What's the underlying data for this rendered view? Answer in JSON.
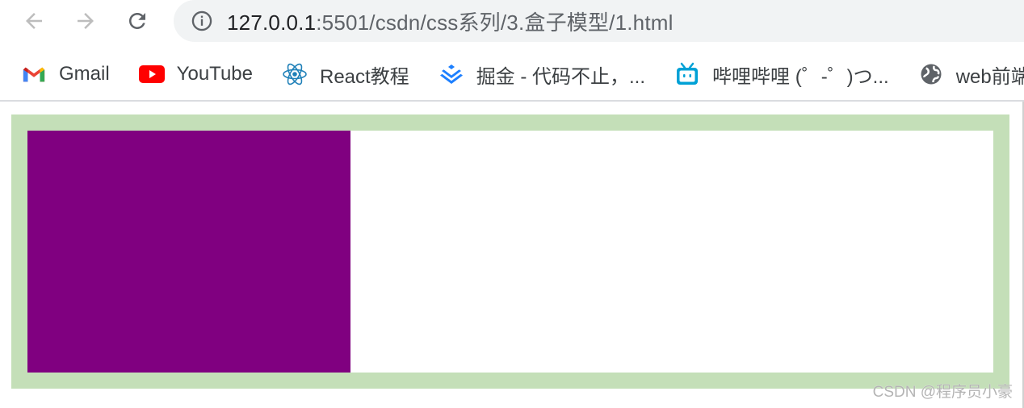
{
  "browser": {
    "nav": {
      "back_icon": "arrow-left-icon",
      "forward_icon": "arrow-right-icon",
      "reload_icon": "reload-icon"
    },
    "omnibox": {
      "info_icon": "info-icon",
      "url_host": "127.0.0.1",
      "url_rest": ":5501/csdn/css系列/3.盒子模型/1.html"
    },
    "bookmarks": [
      {
        "label": "Gmail",
        "icon": "gmail-icon"
      },
      {
        "label": "YouTube",
        "icon": "youtube-icon"
      },
      {
        "label": "React教程",
        "icon": "react-icon"
      },
      {
        "label": "掘金 - 代码不止，...",
        "icon": "juejin-icon"
      },
      {
        "label": "哔哩哔哩 (゜-゜)つ...",
        "icon": "bilibili-icon"
      },
      {
        "label": "web前端",
        "icon": "globe-icon"
      }
    ]
  },
  "page": {
    "colors": {
      "outer_border": "#c4dfb8",
      "inner_background": "#ffffff",
      "child_box": "#800080"
    }
  },
  "watermark": "CSDN @程序员小豪"
}
